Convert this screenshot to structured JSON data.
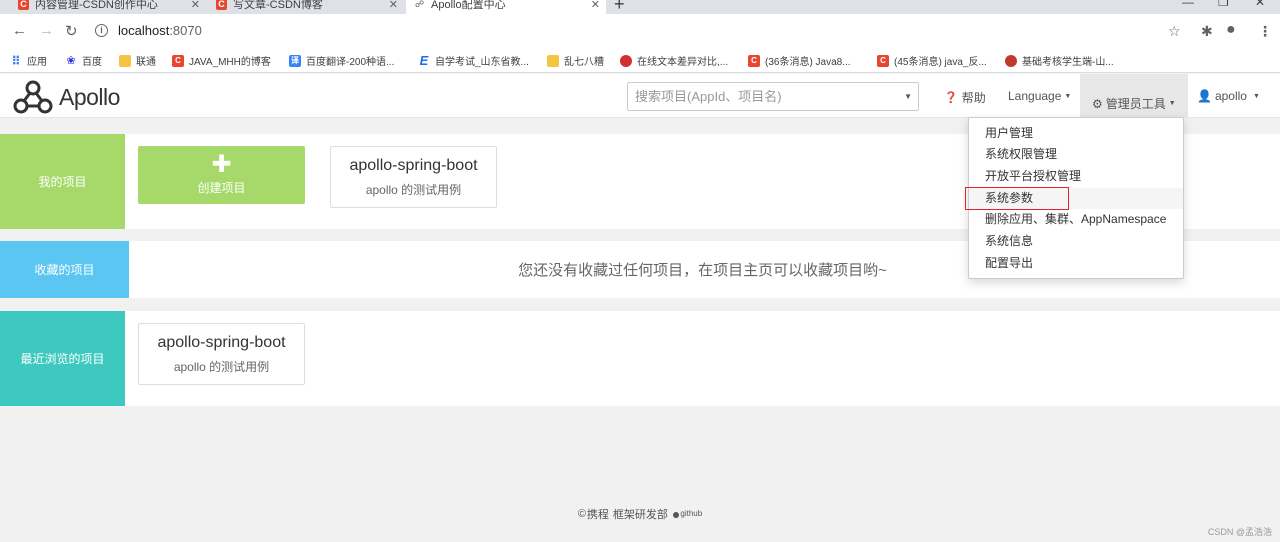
{
  "browser": {
    "tabs": [
      {
        "label": "内容管理-CSDN创作中心",
        "favicon": "C"
      },
      {
        "label": "写文章-CSDN博客",
        "favicon": "C"
      },
      {
        "label": "Apollo配置中心",
        "favicon": "apollo"
      }
    ],
    "url_host": "localhost",
    "url_port": ":8070"
  },
  "bookmarks": [
    {
      "label": "应用",
      "icon": "apps-icon",
      "color": "#4285f4"
    },
    {
      "label": "百度",
      "icon": "baidu-icon",
      "color": "#2932e1"
    },
    {
      "label": "联通",
      "icon": "folder-icon",
      "color": "#f4c542"
    },
    {
      "label": "JAVA_MHH的博客",
      "icon": "C",
      "color": "#e8462f"
    },
    {
      "label": "百度翻译-200种语...",
      "icon": "译",
      "color": "#3b82f6"
    },
    {
      "label": "自学考试_山东省教...",
      "icon": "E",
      "color": "#1f6feb"
    },
    {
      "label": "乱七八糟",
      "icon": "folder-icon",
      "color": "#f4c542"
    },
    {
      "label": "在线文本差异对比,...",
      "icon": "diff-icon",
      "color": "#d32f2f"
    },
    {
      "label": "(36条消息) Java8...",
      "icon": "C",
      "color": "#e8462f"
    },
    {
      "label": "(45条消息) java_反...",
      "icon": "C",
      "color": "#e8462f"
    },
    {
      "label": "基础考核学生端-山...",
      "icon": "school-icon",
      "color": "#c0392b"
    }
  ],
  "navbar": {
    "brand": "Apollo",
    "search_placeholder": "搜索项目(AppId、项目名)",
    "help": "帮助",
    "language": "Language",
    "admin_tools": "管理员工具",
    "user": "apollo"
  },
  "admin_menu": [
    "用户管理",
    "系统权限管理",
    "开放平台授权管理",
    "系统参数",
    "删除应用、集群、AppNamespace",
    "系统信息",
    "配置导出"
  ],
  "sections": {
    "my_projects": {
      "label": "我的项目",
      "color": "#a6d96a",
      "create_label": "创建项目",
      "projects": [
        {
          "name": "apollo-spring-boot",
          "desc": "apollo 的测试用例"
        }
      ]
    },
    "favorites": {
      "label": "收藏的项目",
      "color": "#5bc6f2",
      "empty_text": "您还没有收藏过任何项目，在项目主页可以收藏项目哟~"
    },
    "recent": {
      "label": "最近浏览的项目",
      "color": "#3ec9c0",
      "projects": [
        {
          "name": "apollo-spring-boot",
          "desc": "apollo 的测试用例"
        }
      ]
    }
  },
  "footer": {
    "company": "携程",
    "dept": "框架研发部",
    "github": "github"
  },
  "watermark": "CSDN @孟浩浩"
}
